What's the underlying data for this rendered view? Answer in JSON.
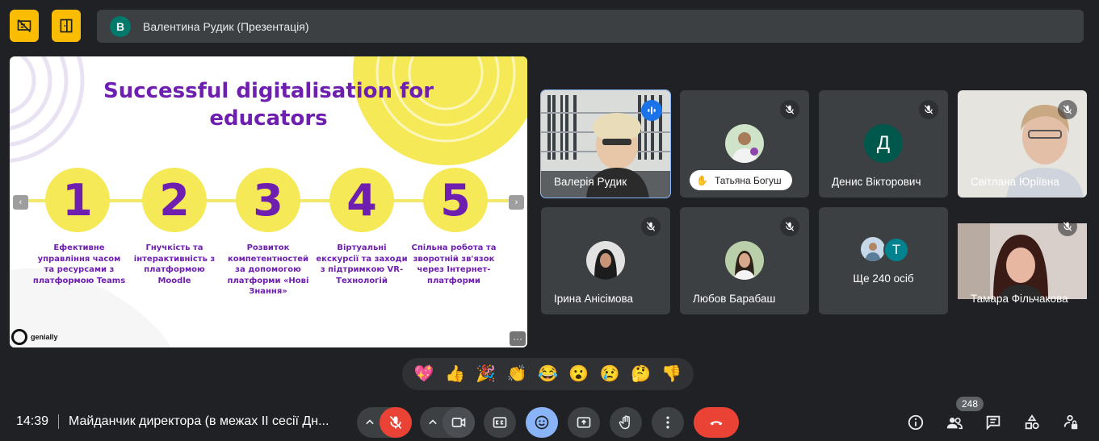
{
  "presenter": {
    "initial": "В",
    "label": "Валентина Рудик (Презентація)"
  },
  "slide": {
    "title_line1": "Successful digitalisation for",
    "title_line2": "educators",
    "steps": [
      {
        "number": "1",
        "text": "Ефективне управління часом та ресурсами з платформою Teams"
      },
      {
        "number": "2",
        "text": "Гнучкість та інтерактивність з платформою Moodle"
      },
      {
        "number": "3",
        "text": "Розвиток компетентностей за допомогою платформи «Нові Знання»"
      },
      {
        "number": "4",
        "text": "Віртуальні екскурсії та заходи з підтримкою VR-Технологій"
      },
      {
        "number": "5",
        "text": "Спільна робота та зворотній зв'язок через Інтернет-платформи"
      }
    ],
    "prev_arrow": "‹",
    "next_arrow": "›",
    "brand": "genially",
    "more_label": "···"
  },
  "participants": [
    {
      "name": "Валерія Рудик",
      "status": "speaking"
    },
    {
      "name": "Татьяна Богуш",
      "status": "muted",
      "hand_raised": true
    },
    {
      "name": "Денис Вікторович",
      "status": "muted",
      "initial": "Д"
    },
    {
      "name": "Світлана Юріївна",
      "status": "muted"
    },
    {
      "name": "Ірина Анісімова",
      "status": "muted"
    },
    {
      "name": "Любов Барабаш",
      "status": "muted"
    },
    {
      "name": "Ще 240 осіб",
      "initial": "Т"
    },
    {
      "name": "Тамара Фільчакова",
      "status": "muted"
    }
  ],
  "reactions": [
    "💖",
    "👍",
    "🎉",
    "👏",
    "😂",
    "😮",
    "😢",
    "🤔",
    "👎"
  ],
  "bottom": {
    "time": "14:39",
    "meeting_title": "Майданчик директора (в межах ІІ сесії Дн...",
    "participant_count": "248"
  },
  "colors": {
    "background": "#202124",
    "tile": "#3c4043",
    "accent_yellow": "#fbbc04",
    "end_call_red": "#ea4335",
    "slide_purple": "#6e1fb0",
    "slide_yellow": "#f6e957"
  }
}
